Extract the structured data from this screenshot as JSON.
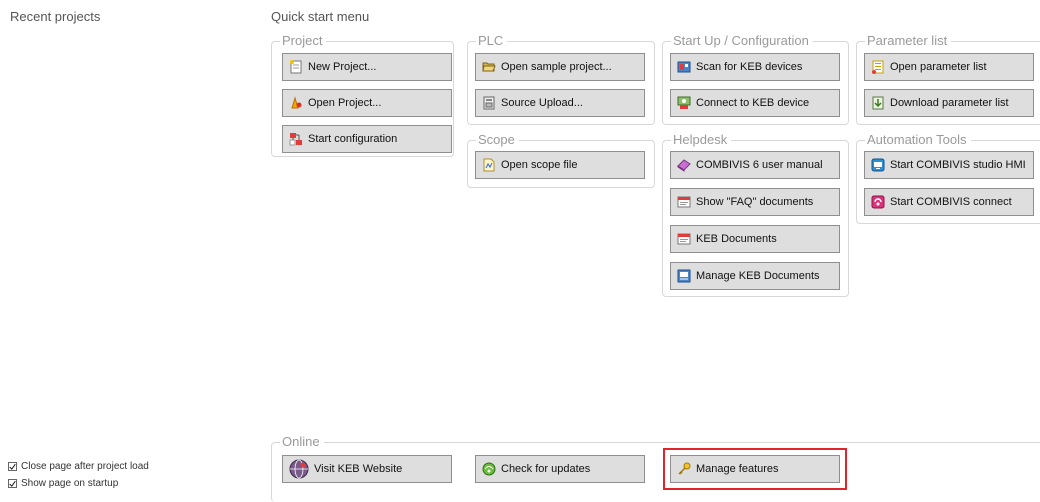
{
  "recent_projects": {
    "title": "Recent projects"
  },
  "quick_start": {
    "title": "Quick start menu"
  },
  "project": {
    "title": "Project",
    "new_project": "New Project...",
    "open_project": "Open Project...",
    "start_configuration": "Start configuration"
  },
  "plc": {
    "title": "PLC",
    "open_sample_project": "Open sample project...",
    "source_upload": "Source Upload..."
  },
  "scope": {
    "title": "Scope",
    "open_scope_file": "Open scope file"
  },
  "startup": {
    "title": "Start Up / Configuration",
    "scan": "Scan for KEB devices",
    "connect": "Connect to KEB device"
  },
  "helpdesk": {
    "title": "Helpdesk",
    "manual": "COMBIVIS 6 user manual",
    "faq": "Show \"FAQ\" documents",
    "keb_docs": "KEB Documents",
    "manage_docs": "Manage KEB Documents"
  },
  "parameter_list": {
    "title": "Parameter list",
    "open": "Open parameter list",
    "download": "Download parameter list"
  },
  "automation": {
    "title": "Automation Tools",
    "hmi": "Start COMBIVIS studio HMI",
    "connect": "Start COMBIVIS connect"
  },
  "online": {
    "title": "Online",
    "visit_website": "Visit KEB Website",
    "check_updates": "Check for updates",
    "manage_features": "Manage features"
  },
  "options": {
    "close_after_load": "Close page after project load",
    "show_on_startup": "Show page on startup"
  },
  "colors": {
    "highlight": "#e0262b",
    "button_bg": "#dedede"
  }
}
